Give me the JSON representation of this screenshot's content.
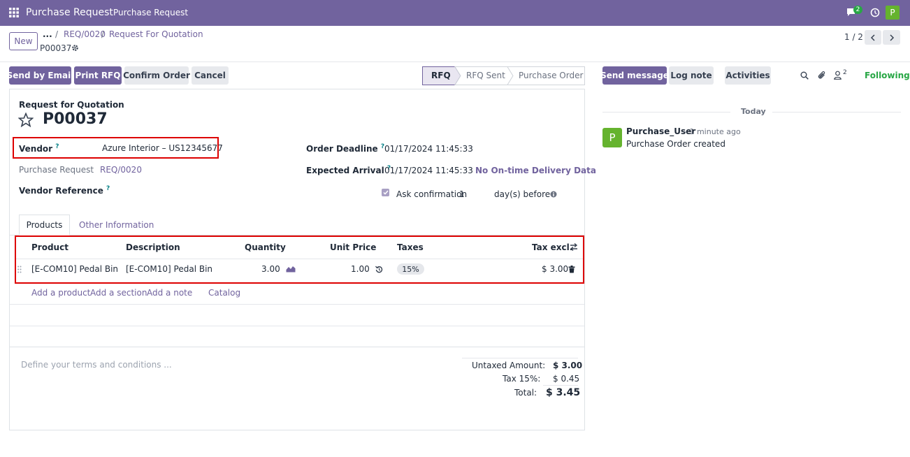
{
  "navbar": {
    "app_name": "Purchase Request",
    "menu_item": "Purchase Request",
    "chat_count": "2",
    "avatar_letter": "P"
  },
  "control": {
    "new_label": "New",
    "ellipsis": "...",
    "breadcrumb_sep": "/",
    "breadcrumb_1": "REQ/0020",
    "breadcrumb_2": "Request For Quotation",
    "record_name": "P00037",
    "pager": "1 / 2"
  },
  "actions": {
    "send_email": "Send by Email",
    "print_rfq": "Print RFQ",
    "confirm_order": "Confirm Order",
    "cancel": "Cancel"
  },
  "statusbar": {
    "stages": [
      "RFQ",
      "RFQ Sent",
      "Purchase Order"
    ],
    "active": "RFQ"
  },
  "form": {
    "doc_type": "Request for Quotation",
    "doc_name": "P00037",
    "vendor_label": "Vendor",
    "vendor_value": "Azure Interior – US12345677",
    "purchase_request_label": "Purchase Request",
    "purchase_request_value": "REQ/0020",
    "vendor_ref_label": "Vendor Reference",
    "help_mark": "?",
    "order_deadline_label": "Order Deadline",
    "order_deadline_value": "01/17/2024 11:45:33",
    "expected_arrival_label": "Expected Arrival",
    "expected_arrival_value": "01/17/2024 11:45:33",
    "no_ontime": "No On-time Delivery Data",
    "ask_confirmation_label": "Ask confirmation",
    "ask_days": "1",
    "days_before": "day(s) before"
  },
  "tabs": [
    "Products",
    "Other Information"
  ],
  "lines": {
    "headers": {
      "product": "Product",
      "description": "Description",
      "quantity": "Quantity",
      "unit_price": "Unit Price",
      "taxes": "Taxes",
      "tax_excl": "Tax excl."
    },
    "rows": [
      {
        "product": "[E-COM10] Pedal Bin",
        "description": "[E-COM10] Pedal Bin",
        "quantity": "3.00",
        "unit_price": "1.00",
        "tax": "15%",
        "subtotal": "$ 3.00"
      }
    ],
    "add_product": "Add a product",
    "add_section": "Add a section",
    "add_note": "Add a note",
    "catalog": "Catalog"
  },
  "terms_placeholder": "Define your terms and conditions ...",
  "totals": {
    "untaxed_label": "Untaxed Amount:",
    "untaxed_value": "$ 3.00",
    "tax_label": "Tax 15%:",
    "tax_value": "$ 0.45",
    "total_label": "Total:",
    "total_value": "$ 3.45"
  },
  "chatter": {
    "send_message": "Send message",
    "log_note": "Log note",
    "activities": "Activities",
    "followers_count": "2",
    "following": "Following",
    "date_sep": "Today",
    "msg_author": "Purchase_User",
    "msg_time": "- 1 minute ago",
    "msg_body": "Purchase Order created",
    "msg_avatar": "P"
  },
  "colors": {
    "brand": "#71639e",
    "following": "#28a745",
    "avatar": "#65b32e",
    "highlight": "#dd0000"
  }
}
